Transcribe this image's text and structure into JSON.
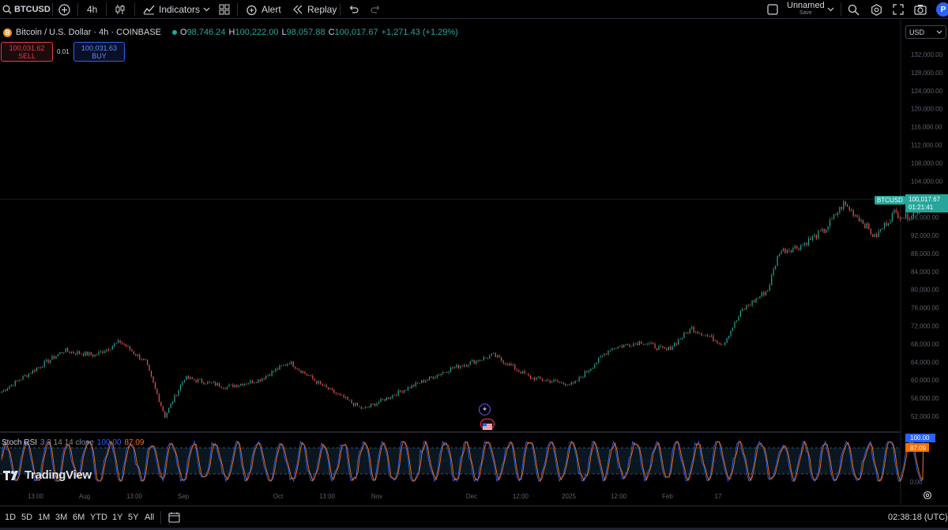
{
  "toolbar": {
    "symbol": "BTCUSD",
    "interval": "4h",
    "indicators_label": "Indicators",
    "alert_label": "Alert",
    "replay_label": "Replay",
    "layout_name": "Unnamed",
    "save_label": "Save",
    "avatar_letter": "P"
  },
  "legend": {
    "coin_letter": "B",
    "title": "Bitcoin / U.S. Dollar · 4h · COINBASE",
    "open_label": "O",
    "open": "98,746.24",
    "high_label": "H",
    "high": "100,222.00",
    "low_label": "L",
    "low": "98,057.88",
    "close_label": "C",
    "close": "100,017.67",
    "change": "+1,271.43 (+1.29%)"
  },
  "trade": {
    "sell_price": "100,031.62",
    "sell_label": "SELL",
    "spread": "0.01",
    "buy_price": "100,031.63",
    "buy_label": "BUY"
  },
  "price_axis": {
    "currency": "USD",
    "labels": [
      "132,000.00",
      "128,000.00",
      "124,000.00",
      "120,000.00",
      "116,000.00",
      "112,000.00",
      "108,000.00",
      "104,000.00",
      "96,000.00",
      "92,000.00",
      "88,000.00",
      "84,000.00",
      "80,000.00",
      "76,000.00",
      "72,000.00",
      "68,000.00",
      "64,000.00",
      "60,000.00",
      "56,000.00",
      "52,000.00"
    ],
    "symbol_tag": "BTCUSD",
    "last_price": "100,017.67",
    "countdown": "01:21:41"
  },
  "chart_data": {
    "type": "candlestick",
    "symbol": "BTCUSD",
    "interval": "4h",
    "ylim": [
      50000,
      134000
    ],
    "close_path": [
      {
        "x": "Jul-10",
        "y": 57500
      },
      {
        "x": "Jul-15",
        "y": 62000
      },
      {
        "x": "Jul-20",
        "y": 66500
      },
      {
        "x": "Jul-25",
        "y": 65500
      },
      {
        "x": "Jul-29",
        "y": 68500
      },
      {
        "x": "Aug-02",
        "y": 64000
      },
      {
        "x": "Aug-05",
        "y": 52000
      },
      {
        "x": "Aug-08",
        "y": 60500
      },
      {
        "x": "Aug-15",
        "y": 58500
      },
      {
        "x": "Aug-20",
        "y": 60000
      },
      {
        "x": "Aug-25",
        "y": 64000
      },
      {
        "x": "Aug-30",
        "y": 59000
      },
      {
        "x": "Sep-06",
        "y": 53500
      },
      {
        "x": "Sep-12",
        "y": 57500
      },
      {
        "x": "Sep-20",
        "y": 62500
      },
      {
        "x": "Sep-27",
        "y": 65500
      },
      {
        "x": "Oct-03",
        "y": 60500
      },
      {
        "x": "Oct-10",
        "y": 59000
      },
      {
        "x": "Oct-16",
        "y": 67000
      },
      {
        "x": "Oct-21",
        "y": 68500
      },
      {
        "x": "Oct-25",
        "y": 66500
      },
      {
        "x": "Oct-29",
        "y": 71500
      },
      {
        "x": "Nov-03",
        "y": 68000
      },
      {
        "x": "Nov-06",
        "y": 75500
      },
      {
        "x": "Nov-10",
        "y": 80000
      },
      {
        "x": "Nov-12",
        "y": 88500
      },
      {
        "x": "Nov-15",
        "y": 89500
      },
      {
        "x": "Nov-19",
        "y": 93000
      },
      {
        "x": "Nov-22",
        "y": 99000
      },
      {
        "x": "Nov-25",
        "y": 95000
      },
      {
        "x": "Nov-27",
        "y": 91500
      },
      {
        "x": "Nov-30",
        "y": 97000
      },
      {
        "x": "Dec-02",
        "y": 96000
      },
      {
        "x": "Dec-04",
        "y": 97500
      },
      {
        "x": "Dec-05",
        "y": 100017.67
      }
    ],
    "last_price": 100017.67,
    "x_ticks": [
      "13:00",
      "Aug",
      "13:00",
      "Sep",
      "Oct",
      "13:00",
      "Nov",
      "Dec",
      "12:00",
      "2025",
      "12:00",
      "Feb",
      "17"
    ],
    "x_ticks_range": [
      "Jul-10",
      "Feb-17"
    ],
    "grid": false
  },
  "rsi": {
    "name": "Stoch RSI",
    "params": "3 3 14 14 close",
    "k_value": "100.00",
    "d_value": "87.09",
    "axis_labels": [
      "100.00",
      "87.09",
      "0.00"
    ],
    "k_color": "#2962ff",
    "d_color": "#ff6d00",
    "band_upper": 80,
    "band_lower": 20
  },
  "watermark": "TradingView",
  "bottom": {
    "ranges": [
      "1D",
      "5D",
      "1M",
      "3M",
      "6M",
      "YTD",
      "1Y",
      "5Y",
      "All"
    ],
    "clock": "02:38:18 (UTC)"
  },
  "colors": {
    "up": "#26a69a",
    "down": "#ef5350",
    "accent": "#2962ff",
    "background": "#000000"
  }
}
